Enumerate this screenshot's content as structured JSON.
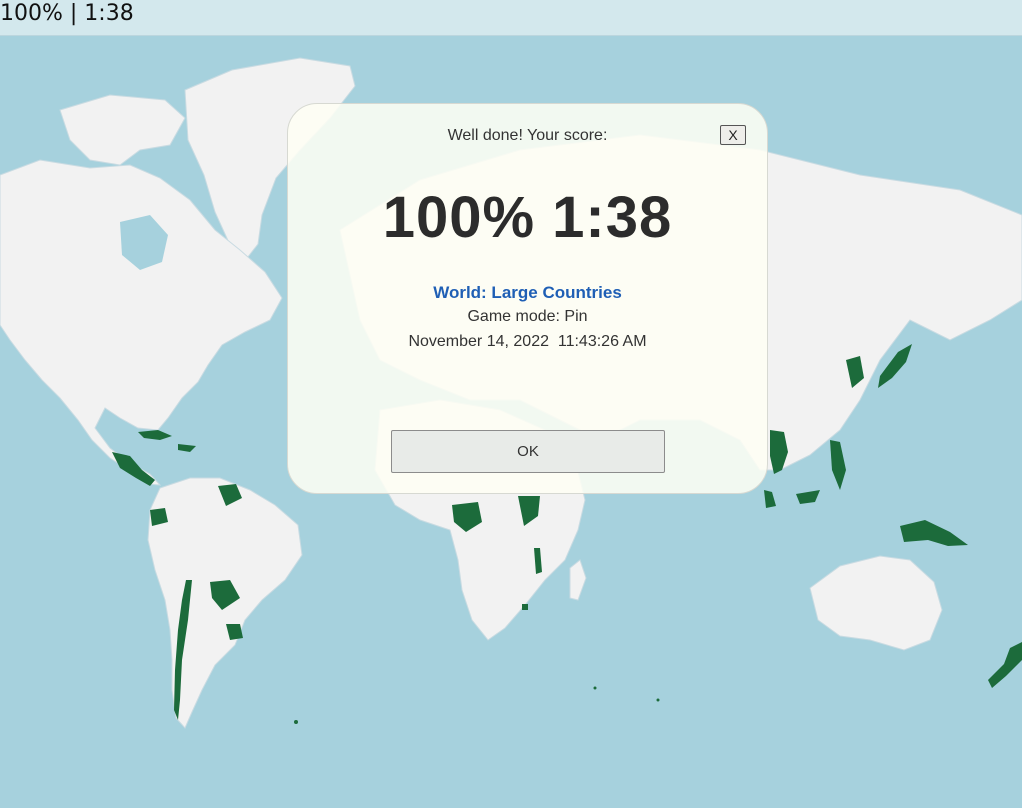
{
  "topbar": {
    "status": "100% | 1:38"
  },
  "modal": {
    "heading": "Well done! Your score:",
    "close_label": "X",
    "score": "100% 1:38",
    "quiz_title": "World: Large Countries",
    "game_mode": "Game mode: Pin",
    "timestamp": "November 14, 2022  11:43:26 AM",
    "ok_label": "OK"
  },
  "colors": {
    "ocean": "#a6d1dd",
    "land": "#f2f2f2",
    "found_country": "#1c6b3b",
    "link": "#1f5fb5"
  }
}
